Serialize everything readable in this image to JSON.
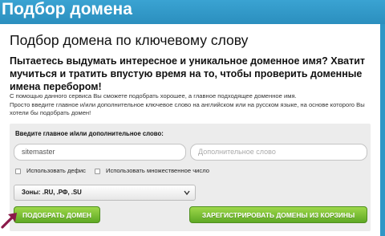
{
  "header": {
    "title": "Подбор домена"
  },
  "main": {
    "heading": "Подбор домена по ключевому слову",
    "lead": "Пытаетесь выдумать интересное и уникальное доменное имя? Хватит мучиться и тратить впустую время на то, чтобы проверить доменные имена перебором!",
    "desc_line1": "С помощью данного сервиса Вы сможете подобрать хорошее, а главное подходящее доменное имя.",
    "desc_line2": "Просто введите главное и/или дополнительное ключевое слово на английском или на русском языке, на основе которого Вы хотели бы подобрать домен!"
  },
  "form": {
    "label": "Введите главное и/или дополнительное слово:",
    "main_value": "sitemaster",
    "extra_placeholder": "Дополнительное слово",
    "hyphen_label": "Использовать дефис",
    "plural_label": "Использовать множественное число",
    "zones_value": "Зоны: .RU, .РФ, .SU",
    "pick_button": "ПОДОБРАТЬ ДОМЕН",
    "register_button": "ЗАРЕГИСТРИРОВАТЬ ДОМЕНЫ ИЗ КОРЗИНЫ"
  },
  "colors": {
    "header": "#2f97c6",
    "button": "#6fb52c",
    "arrow": "#8b1a4a"
  },
  "icons": {
    "dropdown": "chevron-down-icon",
    "annotation": "arrow-pointer-icon"
  }
}
